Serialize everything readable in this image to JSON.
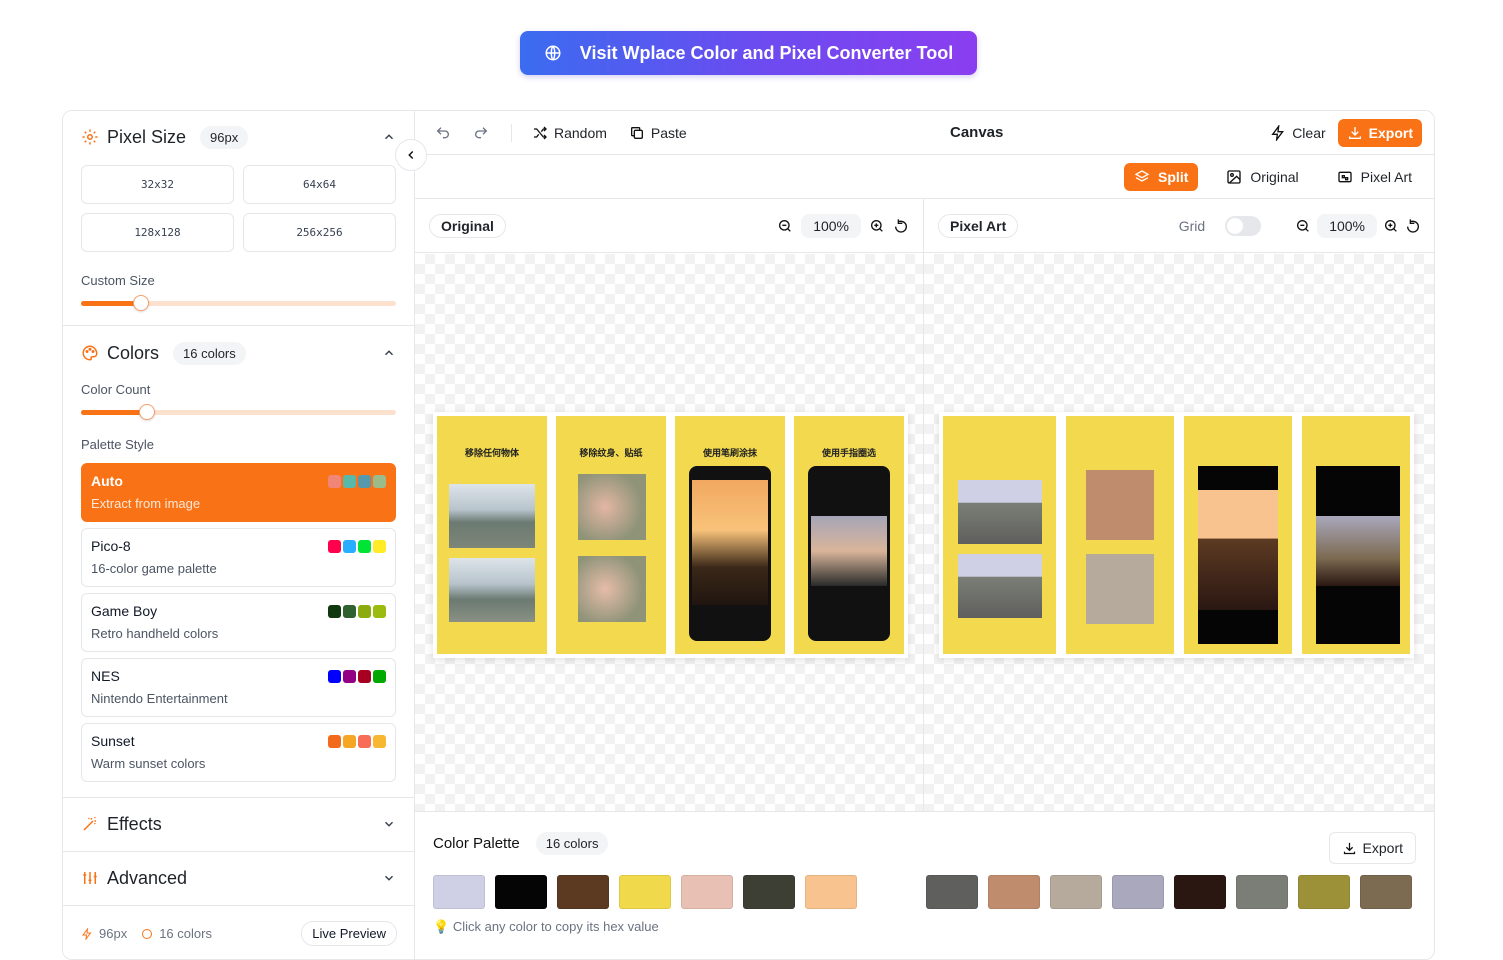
{
  "banner": {
    "label": "Visit Wplace Color and Pixel Converter Tool"
  },
  "sidebar": {
    "pixel_size": {
      "title": "Pixel Size",
      "badge": "96px",
      "presets": [
        "32x32",
        "64x64",
        "128x128",
        "256x256"
      ],
      "custom_label": "Custom Size",
      "custom_value": 0.19
    },
    "colors": {
      "title": "Colors",
      "badge": "16 colors",
      "count_label": "Color Count",
      "count_value": 0.21,
      "palette_label": "Palette Style",
      "palettes": [
        {
          "name": "Auto",
          "desc": "Extract from image",
          "swatches": [
            "#f08a8a",
            "#3cc4c4",
            "#3aa0c8",
            "#8cc8a0"
          ],
          "active": true
        },
        {
          "name": "Pico-8",
          "desc": "16-color game palette",
          "swatches": [
            "#ff004d",
            "#29adff",
            "#00e436",
            "#ffec27"
          ]
        },
        {
          "name": "Game Boy",
          "desc": "Retro handheld colors",
          "swatches": [
            "#0f380f",
            "#306230",
            "#8bac0f",
            "#9bbc0f"
          ]
        },
        {
          "name": "NES",
          "desc": "Nintendo Entertainment",
          "swatches": [
            "#0000fc",
            "#940084",
            "#a80020",
            "#00a800"
          ]
        },
        {
          "name": "Sunset",
          "desc": "Warm sunset colors",
          "swatches": [
            "#f26b1d",
            "#f5a623",
            "#f76d57",
            "#f7b733"
          ]
        }
      ]
    },
    "effects": {
      "title": "Effects"
    },
    "advanced": {
      "title": "Advanced"
    },
    "footer": {
      "pixels": "96px",
      "colors": "16 colors",
      "live": "Live Preview"
    }
  },
  "toolbar": {
    "random": "Random",
    "paste": "Paste",
    "canvas_title": "Canvas",
    "clear": "Clear",
    "export": "Export"
  },
  "view": {
    "split": "Split",
    "original": "Original",
    "pixel_art": "Pixel Art"
  },
  "panes": {
    "original": {
      "label": "Original",
      "zoom": "100%"
    },
    "pixel": {
      "label": "Pixel Art",
      "grid_label": "Grid",
      "zoom": "100%"
    }
  },
  "cards": {
    "c1": "移除任何物体",
    "c2": "移除纹身、贴纸",
    "c3": "使用笔刷涂抹",
    "c4": "使用手指圈选"
  },
  "palette": {
    "title": "Color Palette",
    "badge": "16 colors",
    "export": "Export",
    "hint": "Click any color to copy its hex value",
    "left": [
      "#cfd0e6",
      "#050505",
      "#5c3a22",
      "#f1d94c",
      "#e8c0b4",
      "#3d3f34",
      "#f8c38e"
    ],
    "right": [
      "#5f5f5d",
      "#c08c6e",
      "#b6aa9c",
      "#a9a8bc",
      "#2a1712",
      "#7b7e76",
      "#9c9138",
      "#7c6a51"
    ]
  },
  "colors": {
    "accent": "#f97316"
  }
}
